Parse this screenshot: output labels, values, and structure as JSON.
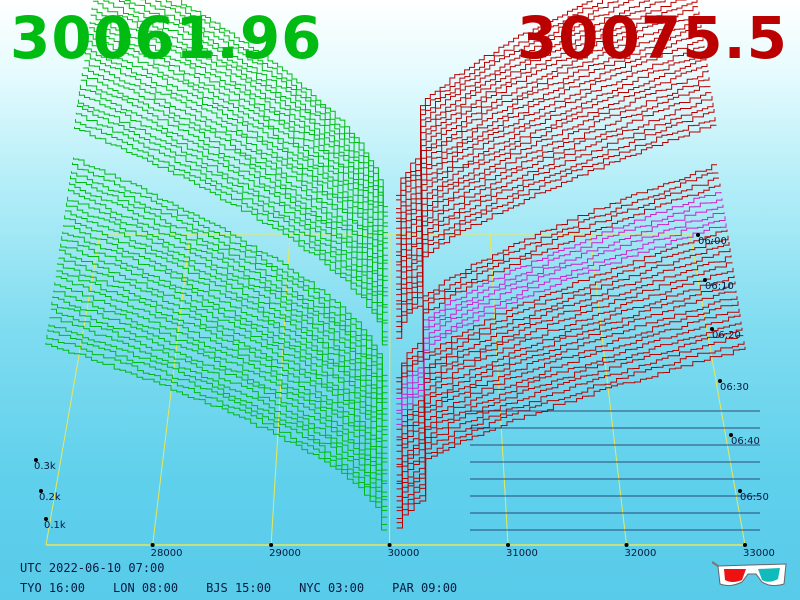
{
  "header": {
    "bid_price": "30061.96",
    "ask_price": "30075.5",
    "bid_color": "#00bb11",
    "ask_color": "#bb0000"
  },
  "footer": {
    "utc_time": "UTC 2022-06-10 07:00",
    "timezones": [
      "TYO 16:00",
      "LON 08:00",
      "BJS 15:00",
      "NYC 03:00",
      "PAR 09:00"
    ],
    "icon": "3d-glasses-icon"
  },
  "chart_data": {
    "type": "3d-depth",
    "price_axis": {
      "ticks": [
        "28000",
        "29000",
        "30000",
        "31000",
        "32000",
        "33000"
      ],
      "range": [
        27000,
        33500
      ]
    },
    "volume_axis": {
      "ticks": [
        "0.1k",
        "0.2k",
        "0.3k"
      ]
    },
    "time_axis": {
      "ticks": [
        "06:00",
        "06:10",
        "06:20",
        "06:30",
        "06:40",
        "06:50"
      ]
    },
    "bid_color": "#00bb11",
    "ask_color": "#bb0000",
    "grid_color": "#e8e85a"
  }
}
